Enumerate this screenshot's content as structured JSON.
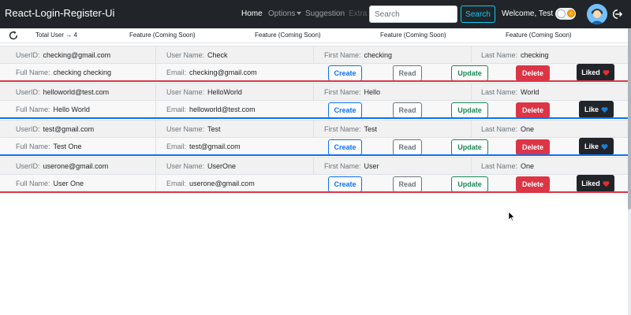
{
  "navbar": {
    "brand": "React-Login-Register-Ui",
    "links": {
      "home": "Home",
      "options": "Options",
      "suggestion": "Suggestion",
      "extra": "Extra"
    },
    "search_placeholder": "Search",
    "search_button": "Search",
    "welcome": "Welcome, Test"
  },
  "stats": {
    "total_user": "Total User → 4",
    "features": [
      "Feature (Coming Soon)",
      "Feature (Coming Soon)",
      "Feature (Coming Soon)",
      "Feature (Coming Soon)"
    ]
  },
  "labels": {
    "user_id": "UserID:",
    "user_name": "User Name:",
    "first_name": "First Name:",
    "last_name": "Last Name:",
    "full_name": "Full Name:",
    "email": "Email:"
  },
  "buttons": {
    "create": "Create",
    "read": "Read",
    "update": "Update",
    "delete": "Delete"
  },
  "users": [
    {
      "user_id": "checking@gmail.com",
      "user_name": "Check",
      "first_name": "checking",
      "last_name": "checking",
      "full_name": "checking checking",
      "email": "checking@gmail.com",
      "like_label": "Liked",
      "liked": true,
      "divider_color": "#dc3545"
    },
    {
      "user_id": "helloworld@test.com",
      "user_name": "HelloWorld",
      "first_name": "Hello",
      "last_name": "World",
      "full_name": "Hello World",
      "email": "helloworld@test.com",
      "like_label": "Like",
      "liked": false,
      "divider_color": "#0d6efd"
    },
    {
      "user_id": "test@gmail.com",
      "user_name": "Test",
      "first_name": "Test",
      "last_name": "One",
      "full_name": "Test One",
      "email": "test@gmail.com",
      "like_label": "Like",
      "liked": false,
      "divider_color": "#0d6efd"
    },
    {
      "user_id": "userone@gmail.com",
      "user_name": "UserOne",
      "first_name": "User",
      "last_name": "One",
      "full_name": "User One",
      "email": "userone@gmail.com",
      "like_label": "Liked",
      "liked": true,
      "divider_color": "#dc3545"
    }
  ],
  "colors": {
    "navbar": "#212529",
    "primary": "#0d6efd",
    "danger": "#dc3545",
    "success": "#198754",
    "secondary": "#6c757d",
    "info": "#0dcaf0",
    "heart_red": "#e03131",
    "heart_blue": "#1c7ed6"
  },
  "icons": {
    "refresh": "refresh-icon",
    "logout": "logout-icon",
    "theme_toggle": "sun-icon",
    "liked_heart": "red-heart-icon",
    "like_heart": "blue-heart-icon"
  }
}
